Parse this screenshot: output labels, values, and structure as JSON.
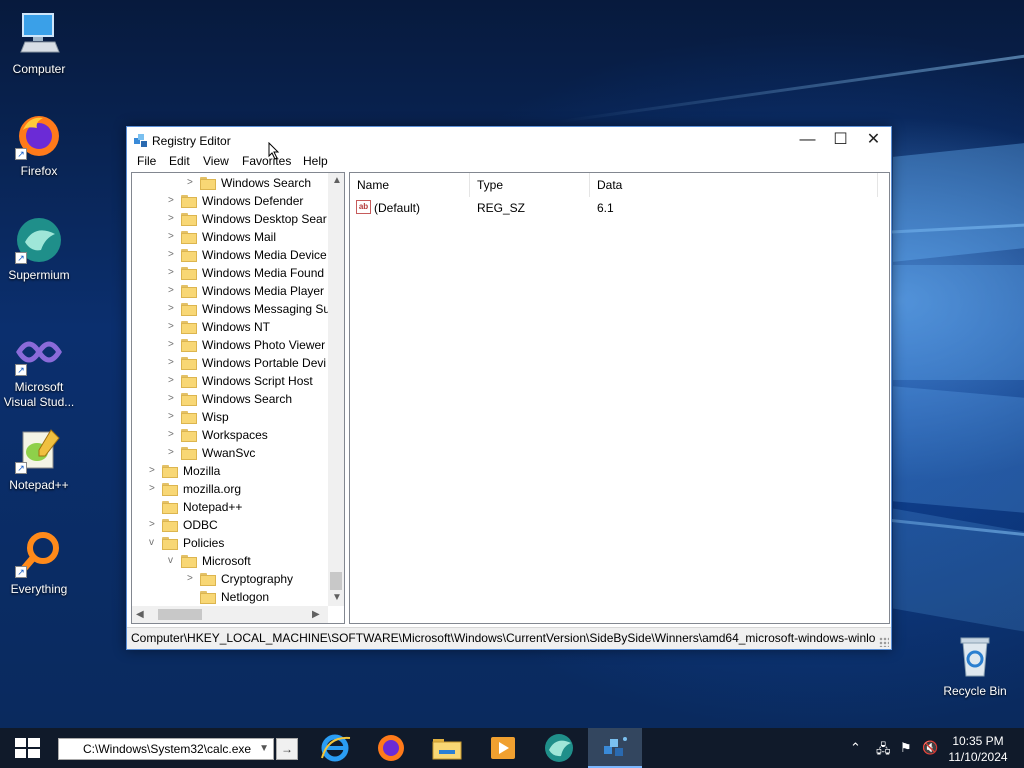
{
  "desktop": {
    "icons": [
      {
        "label": "Computer",
        "icon": "computer-icon"
      },
      {
        "label": "Firefox",
        "icon": "firefox-icon"
      },
      {
        "label": "Supermium",
        "icon": "supermium-icon"
      },
      {
        "label": "Microsoft Visual Stud...",
        "icon": "visual-studio-icon"
      },
      {
        "label": "Notepad++",
        "icon": "notepadpp-icon"
      },
      {
        "label": "Everything",
        "icon": "everything-icon"
      },
      {
        "label": "Recycle Bin",
        "icon": "recycle-bin-icon"
      }
    ]
  },
  "window": {
    "title": "Registry Editor",
    "controls": {
      "minimize": "—",
      "maximize": "☐",
      "close": "✕"
    },
    "menu": [
      "File",
      "Edit",
      "View",
      "Favorites",
      "Help"
    ],
    "tree": [
      {
        "label": "Windows Search",
        "depth": 3,
        "arrow": ">"
      },
      {
        "label": "Windows Defender",
        "depth": 2,
        "arrow": ">"
      },
      {
        "label": "Windows Desktop Sear",
        "depth": 2,
        "arrow": ">"
      },
      {
        "label": "Windows Mail",
        "depth": 2,
        "arrow": ">"
      },
      {
        "label": "Windows Media Device",
        "depth": 2,
        "arrow": ">"
      },
      {
        "label": "Windows Media Found",
        "depth": 2,
        "arrow": ">"
      },
      {
        "label": "Windows Media Player",
        "depth": 2,
        "arrow": ">"
      },
      {
        "label": "Windows Messaging Su",
        "depth": 2,
        "arrow": ">"
      },
      {
        "label": "Windows NT",
        "depth": 2,
        "arrow": ">"
      },
      {
        "label": "Windows Photo Viewer",
        "depth": 2,
        "arrow": ">"
      },
      {
        "label": "Windows Portable Devi",
        "depth": 2,
        "arrow": ">"
      },
      {
        "label": "Windows Script Host",
        "depth": 2,
        "arrow": ">"
      },
      {
        "label": "Windows Search",
        "depth": 2,
        "arrow": ">"
      },
      {
        "label": "Wisp",
        "depth": 2,
        "arrow": ">"
      },
      {
        "label": "Workspaces",
        "depth": 2,
        "arrow": ">"
      },
      {
        "label": "WwanSvc",
        "depth": 2,
        "arrow": ">"
      },
      {
        "label": "Mozilla",
        "depth": 1,
        "arrow": ">"
      },
      {
        "label": "mozilla.org",
        "depth": 1,
        "arrow": ">"
      },
      {
        "label": "Notepad++",
        "depth": 1,
        "arrow": ""
      },
      {
        "label": "ODBC",
        "depth": 1,
        "arrow": ">"
      },
      {
        "label": "Policies",
        "depth": 1,
        "arrow": "v"
      },
      {
        "label": "Microsoft",
        "depth": 2,
        "arrow": "v"
      },
      {
        "label": "Cryptography",
        "depth": 3,
        "arrow": ">"
      },
      {
        "label": "Netlogon",
        "depth": 3,
        "arrow": ""
      }
    ],
    "columns": [
      "Name",
      "Type",
      "Data"
    ],
    "values": [
      {
        "name": "(Default)",
        "type": "REG_SZ",
        "data": "6.1"
      }
    ],
    "status_path": "Computer\\HKEY_LOCAL_MACHINE\\SOFTWARE\\Microsoft\\Windows\\CurrentVersion\\SideBySide\\Winners\\amd64_microsoft-windows-winlo"
  },
  "taskbar": {
    "run_value": "C:\\Windows\\System32\\calc.exe",
    "go_label": "→",
    "pinned": [
      "internet-explorer-icon",
      "firefox-icon",
      "file-explorer-icon",
      "media-player-icon",
      "supermium-icon",
      "registry-editor-icon"
    ],
    "active_app": "registry-editor-icon",
    "tray_icons": [
      "chevron-up-icon",
      "network-icon",
      "flag-icon",
      "volume-muted-icon"
    ],
    "time": "10:35 PM",
    "date": "11/10/2024"
  },
  "colors": {
    "accent": "#0078d7",
    "folder": "#f8d775",
    "taskbar": "#101a2a"
  }
}
